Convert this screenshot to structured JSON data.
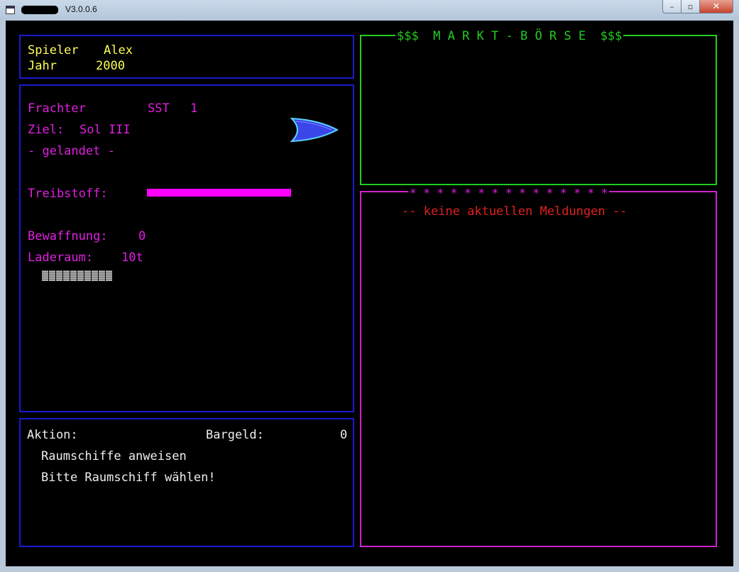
{
  "window": {
    "title": "V3.0.0.6",
    "min_label": "–",
    "max_label": "▫",
    "close_label": "✕"
  },
  "player": {
    "name_label": "Spieler",
    "name": "Alex",
    "year_label": "Jahr",
    "year": "2000"
  },
  "ship": {
    "type_label": "Frachter",
    "id_label": "SST",
    "id_number": "1",
    "destination_label": "Ziel:",
    "destination": "Sol III",
    "status": "- gelandet -",
    "fuel_label": "Treibstoff:",
    "fuel_level": 1.0,
    "armament_label": "Bewaffnung:",
    "armament": "0",
    "cargo_label": "Laderaum:",
    "cargo": "10t",
    "ship_icon": "spaceship-icon"
  },
  "action": {
    "action_label": "Aktion:",
    "cash_label": "Bargeld:",
    "cash": "0",
    "line1": "Raumschiffe anweisen",
    "line2": "Bitte Raumschiff wählen!"
  },
  "market": {
    "title": "$$$  M A R K T - B Ö R S E  $$$"
  },
  "news": {
    "title": "* * * * * * * * * * * * * * *",
    "message": "-- keine aktuellen Meldungen --"
  },
  "colors": {
    "background": "#000000",
    "panel_border_blue": "#1a1ad0",
    "market_green": "#22cc22",
    "news_magenta": "#cc22cc",
    "text_yellow": "#ffff55",
    "text_magenta": "#e01fe0",
    "fuel_bar": "#ff00ff",
    "news_red": "#e02020"
  }
}
